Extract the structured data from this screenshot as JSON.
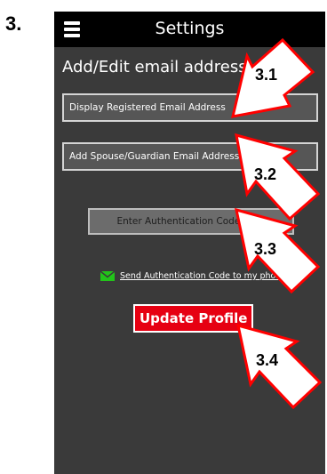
{
  "step": {
    "number": "3."
  },
  "header": {
    "title": "Settings",
    "menu_icon": "hamburger-menu-icon"
  },
  "section": {
    "title": "Add/Edit email address"
  },
  "fields": {
    "registered_email": "Display Registered Email Address",
    "spouse_email": "Add Spouse/Guardian Email Address",
    "auth_code": "Enter Authentication Code Here"
  },
  "send_link": {
    "label": "Send Authentication Code to my phone",
    "icon": "envelope-icon"
  },
  "update_button": {
    "label": "Update Profile"
  },
  "callouts": [
    "3.1",
    "3.2",
    "3.3",
    "3.4"
  ],
  "colors": {
    "background": "#3a3a3a",
    "header": "#000000",
    "accent_red": "#e60012",
    "link_green": "#22c41a",
    "callout_fill": "#ffffff",
    "callout_stroke": "#ff0000"
  }
}
